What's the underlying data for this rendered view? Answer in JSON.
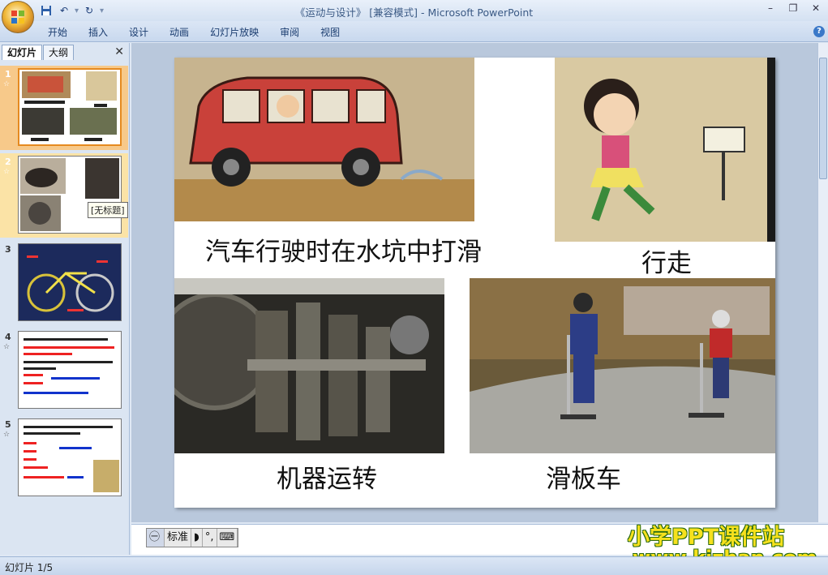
{
  "window": {
    "title": "《运动与设计》 [兼容模式] - Microsoft PowerPoint"
  },
  "quick_access": {
    "save_icon": "save-icon",
    "undo_icon": "undo-icon",
    "redo_icon": "redo-icon"
  },
  "ribbon": {
    "tabs": [
      "开始",
      "插入",
      "设计",
      "动画",
      "幻灯片放映",
      "审阅",
      "视图"
    ]
  },
  "panel": {
    "tabs": [
      "幻灯片",
      "大纲"
    ],
    "close": "✕"
  },
  "thumbnails": [
    {
      "num": "1"
    },
    {
      "num": "2"
    },
    {
      "num": "3"
    },
    {
      "num": "4"
    },
    {
      "num": "5"
    }
  ],
  "tooltip": "[无标题]",
  "slide": {
    "captions": {
      "car": "汽车行驶时在水坑中打滑",
      "walk": "行走",
      "machine": "机器运转",
      "scooter": "滑板车"
    }
  },
  "ime": {
    "mode": "标准"
  },
  "watermark": {
    "line1": "小学PPT课件站",
    "line2": "www.kjzhan.com"
  },
  "status": {
    "slide_counter": "幻灯片 1/5"
  }
}
